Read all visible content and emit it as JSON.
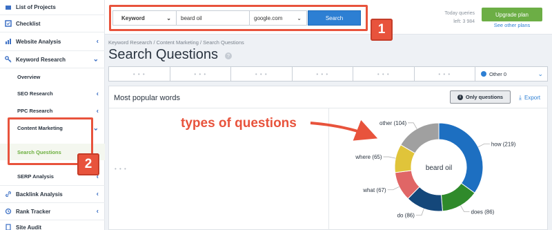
{
  "sidebar": {
    "items": [
      {
        "label": "List of Projects",
        "icon": "folder-icon"
      },
      {
        "label": "Checklist",
        "icon": "checklist-icon"
      },
      {
        "label": "Website Analysis",
        "icon": "chart-icon"
      },
      {
        "label": "Keyword Research",
        "icon": "key-icon"
      },
      {
        "label": "Backlink Analysis",
        "icon": "link-icon"
      },
      {
        "label": "Rank Tracker",
        "icon": "history-icon"
      },
      {
        "label": "Site Audit",
        "icon": "audit-icon"
      }
    ],
    "sub_items": [
      {
        "label": "Overview"
      },
      {
        "label": "SEO Research"
      },
      {
        "label": "PPC Research"
      },
      {
        "label": "Content Marketing"
      },
      {
        "label": "Search Questions"
      },
      {
        "label": "SERP Analysis"
      }
    ],
    "highlight_color": "#e8533c",
    "active_color": "#6caf3e"
  },
  "topbar": {
    "search_type": "Keyword",
    "query_value": "beard oil",
    "database": "google.com",
    "search_label": "Search",
    "queries_line1": "Today queries",
    "queries_line2": "left: 3 984",
    "upgrade_label": "Upgrade plan",
    "other_plans_label": "See other plans"
  },
  "badges": {
    "one": "1",
    "two": "2"
  },
  "breadcrumb": "Keyword Research / Content Marketing / Search Questions",
  "page_title": "Search Questions",
  "filters": {
    "placeholders": [
      "• • •",
      "• • •",
      "• • •",
      "• • •",
      "• • •",
      "• • •"
    ],
    "other_label": "Other 0"
  },
  "card": {
    "title": "Most popular words",
    "only_questions_label": "Only questions",
    "export_label": "Export",
    "loading": "• • •",
    "annotation": "types of questions"
  },
  "chart_data": {
    "type": "pie",
    "center_label": "beard oil",
    "slices": [
      {
        "label": "how",
        "value": 219,
        "text": "how (219)",
        "color": "#1d6fc1"
      },
      {
        "label": "does",
        "value": 86,
        "text": "does (86)",
        "color": "#2f8a2b"
      },
      {
        "label": "do",
        "value": 86,
        "text": "do (86)",
        "color": "#14477a"
      },
      {
        "label": "what",
        "value": 67,
        "text": "what (67)",
        "color": "#e06666"
      },
      {
        "label": "where",
        "value": 65,
        "text": "where (65)",
        "color": "#e0c43a"
      },
      {
        "label": "other",
        "value": 104,
        "text": "other (104)",
        "color": "#a0a0a0"
      }
    ]
  }
}
